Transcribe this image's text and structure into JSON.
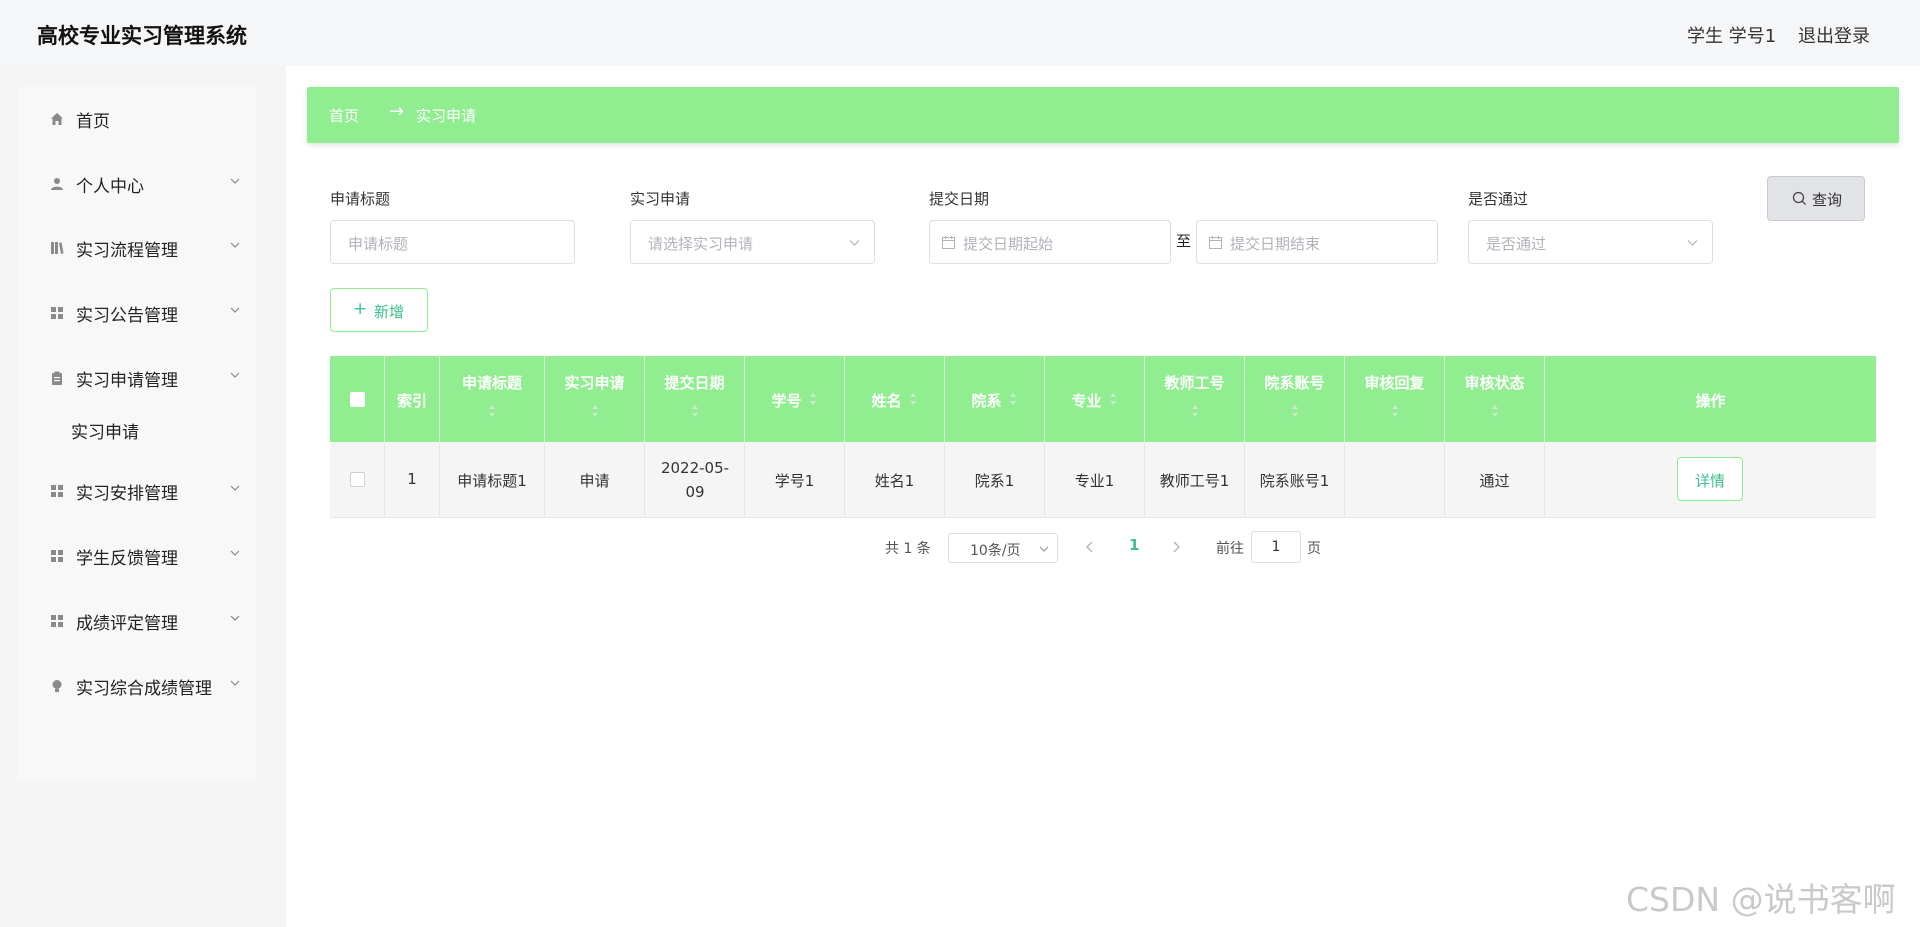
{
  "header": {
    "title": "高校专业实习管理系统",
    "user": "学生 学号1",
    "logout": "退出登录"
  },
  "sidebar": {
    "items": [
      {
        "label": "首页",
        "icon": "home-icon"
      },
      {
        "label": "个人中心",
        "icon": "user-icon"
      },
      {
        "label": "实习流程管理",
        "icon": "library-icon"
      },
      {
        "label": "实习公告管理",
        "icon": "grid-icon"
      },
      {
        "label": "实习申请管理",
        "icon": "clipboard-icon"
      },
      {
        "label": "实习安排管理",
        "icon": "grid-icon"
      },
      {
        "label": "学生反馈管理",
        "icon": "grid-icon"
      },
      {
        "label": "成绩评定管理",
        "icon": "grid-icon"
      },
      {
        "label": "实习综合成绩管理",
        "icon": "bulb-icon"
      }
    ],
    "submenu_active": "实习申请"
  },
  "breadcrumb": {
    "home": "首页",
    "separator": "→",
    "current": "实习申请"
  },
  "search": {
    "title_label": "申请标题",
    "title_placeholder": "申请标题",
    "apply_label": "实习申请",
    "apply_placeholder": "请选择实习申请",
    "date_label": "提交日期",
    "date_start_placeholder": "提交日期起始",
    "date_sep": "至",
    "date_end_placeholder": "提交日期结束",
    "pass_label": "是否通过",
    "pass_placeholder": "是否通过",
    "query_button": "查询",
    "add_button": "新增"
  },
  "table": {
    "columns": [
      "索引",
      "申请标题",
      "实习申请",
      "提交日期",
      "学号",
      "姓名",
      "院系",
      "专业",
      "教师工号",
      "院系账号",
      "审核回复",
      "审核状态",
      "操作"
    ],
    "rows": [
      {
        "index": "1",
        "title": "申请标题1",
        "apply": "申请",
        "date": "2022-05-09",
        "student_no": "学号1",
        "name": "姓名1",
        "dept": "院系1",
        "major": "专业1",
        "teacher_no": "教师工号1",
        "dept_account": "院系账号1",
        "reply": "",
        "status": "通过",
        "action": "详情"
      }
    ]
  },
  "pagination": {
    "total": "共 1 条",
    "page_size": "10条/页",
    "current_page": "1",
    "goto_prefix": "前往",
    "goto_value": "1",
    "goto_suffix": "页"
  },
  "watermark": "CSDN @说书客啊",
  "colors": {
    "accent": "#90ee90",
    "accent_text": "#3cc08c"
  }
}
